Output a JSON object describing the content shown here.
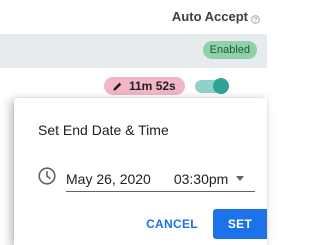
{
  "header": {
    "auto_accept_label": "Auto Accept",
    "help_icon": "help-circle-icon"
  },
  "row_enabled": {
    "badge_label": "Enabled"
  },
  "row_timer": {
    "timer_label": "11m 52s",
    "timer_icon": "pencil-icon",
    "toggle_state": "on"
  },
  "dialog": {
    "title": "Set End Date & Time",
    "date_value": "May 26, 2020",
    "time_value": "03:30pm",
    "clock_icon": "clock-icon",
    "cancel_label": "CANCEL",
    "set_label": "SET"
  },
  "colors": {
    "accent": "#1a73e8",
    "enabled_badge": "#8fd1a8",
    "timer_pill": "#f2b6c6",
    "toggle_on": "#2aa498",
    "row_highlight": "#e8ebee"
  }
}
